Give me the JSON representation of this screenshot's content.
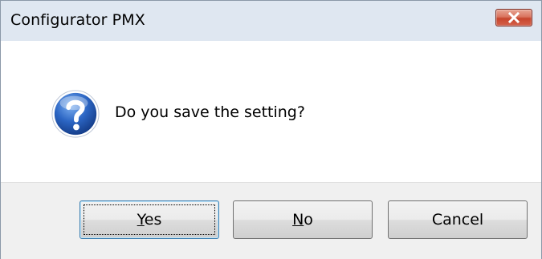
{
  "window": {
    "title": "Configurator PMX",
    "close_icon": "close-x-icon"
  },
  "dialog": {
    "icon": "question-icon",
    "message": "Do you save the setting?"
  },
  "buttons": {
    "yes": {
      "mnemonic": "Y",
      "rest": "es"
    },
    "no": {
      "mnemonic": "N",
      "rest": "o"
    },
    "cancel": {
      "label": "Cancel"
    }
  },
  "colors": {
    "titlebar": "#dfe7f1",
    "close_button": "#c7452d",
    "footer": "#f0f0f0",
    "question_icon": "#1f5ab8"
  }
}
